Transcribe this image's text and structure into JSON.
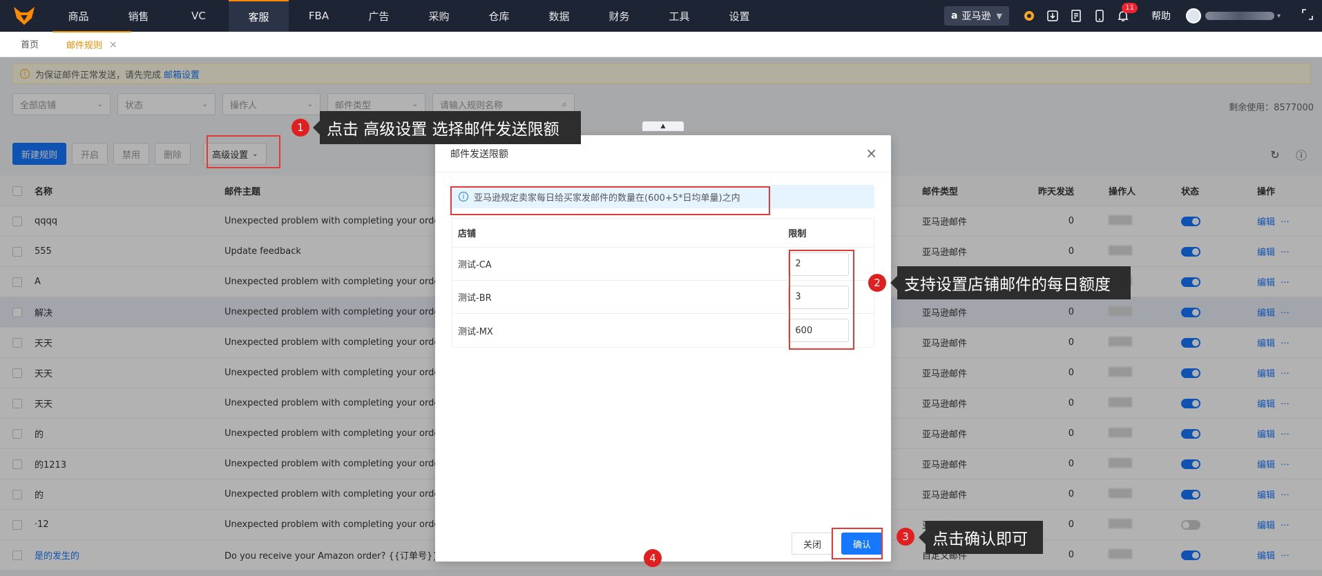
{
  "nav": {
    "items": [
      "商品",
      "销售",
      "VC",
      "客服",
      "FBA",
      "广告",
      "采购",
      "仓库",
      "数据",
      "财务",
      "工具",
      "设置"
    ],
    "active_index": 3,
    "marketplace": "亚马逊",
    "notification_count": "11",
    "help": "帮助"
  },
  "tabs": {
    "home": "首页",
    "active": "邮件规则"
  },
  "notice": {
    "text": "为保证邮件正常发送，请先完成",
    "link": "邮箱设置"
  },
  "filters": {
    "shop": "全部店铺",
    "status": "状态",
    "operator": "操作人",
    "mail_type": "邮件类型",
    "search_placeholder": "请输入规则名称"
  },
  "remaining": "剩余使用：8577000",
  "toolbar": {
    "new": "新建规则",
    "enable": "开启",
    "disable": "禁用",
    "delete": "删除",
    "advanced": "高级设置"
  },
  "table": {
    "headers": {
      "name": "名称",
      "subject": "邮件主题",
      "type": "邮件类型",
      "sent": "昨天发送",
      "operator": "操作人",
      "state": "状态",
      "action": "操作"
    },
    "action_label": "编辑",
    "more": "···",
    "rows": [
      {
        "name": "qqqq",
        "subject": "Unexpected problem with completing your order",
        "type": "亚马逊邮件",
        "sent": "0",
        "on": true
      },
      {
        "name": "555",
        "subject": "Update feedback",
        "type": "亚马逊邮件",
        "sent": "0",
        "on": true
      },
      {
        "name": "A",
        "subject": "Unexpected problem with completing your order",
        "type": "亚马逊邮件",
        "sent": "0",
        "on": true
      },
      {
        "name": "解决",
        "subject": "Unexpected problem with completing your order",
        "type": "亚马逊邮件",
        "sent": "0",
        "on": true
      },
      {
        "name": "天天",
        "subject": "Unexpected problem with completing your order",
        "type": "亚马逊邮件",
        "sent": "0",
        "on": true
      },
      {
        "name": "天天",
        "subject": "Unexpected problem with completing your order",
        "type": "亚马逊邮件",
        "sent": "0",
        "on": true
      },
      {
        "name": "天天",
        "subject": "Unexpected problem with completing your order",
        "type": "亚马逊邮件",
        "sent": "0",
        "on": true
      },
      {
        "name": "的",
        "subject": "Unexpected problem with completing your order",
        "type": "亚马逊邮件",
        "sent": "0",
        "on": true
      },
      {
        "name": "的1213",
        "subject": "Unexpected problem with completing your order",
        "type": "亚马逊邮件",
        "sent": "0",
        "on": true
      },
      {
        "name": "的",
        "subject": "Unexpected problem with completing your order",
        "type": "亚马逊邮件",
        "sent": "0",
        "on": true
      },
      {
        "name": "·12",
        "subject": "Unexpected problem with completing your order",
        "type": "亚马逊邮件",
        "sent": "0",
        "on": false
      },
      {
        "name": "是的发生的",
        "subject": "Do you receive your Amazon order? {{订单号}}",
        "type": "自定义邮件",
        "sent": "0",
        "on": true
      }
    ]
  },
  "modal": {
    "title": "邮件发送限额",
    "info": "亚马逊规定卖家每日给买家发邮件的数量在(600+5*日均单量)之内",
    "col_shop": "店铺",
    "col_limit": "限制",
    "rows": [
      {
        "shop": "测试-CA",
        "limit": "2"
      },
      {
        "shop": "测试-BR",
        "limit": "3"
      },
      {
        "shop": "测试-MX",
        "limit": "600"
      }
    ],
    "close": "关闭",
    "confirm": "确认"
  },
  "annotations": {
    "n1": "1",
    "t1": "点击 高级设置 选择邮件发送限额",
    "n2": "2",
    "t2": "支持设置店铺邮件的每日额度",
    "n3": "3",
    "t3": "点击确认即可",
    "n4": "4"
  },
  "colors": {
    "nav_bg": "#1d2434",
    "accent": "#f08c00",
    "primary": "#1677ff",
    "annotation_red": "#e02020"
  }
}
